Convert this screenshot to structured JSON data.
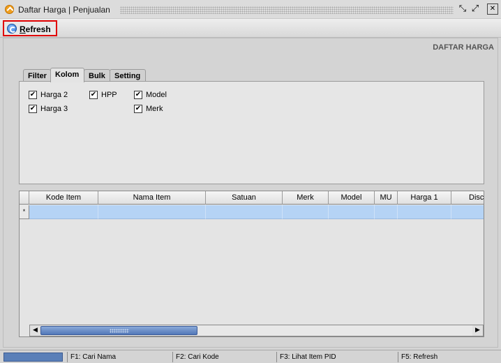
{
  "window": {
    "title": "Daftar Harga | Penjualan",
    "buttons": {
      "restore": "⤡",
      "maximize": "⤢",
      "close": "✕"
    }
  },
  "toolbar": {
    "refresh_mnemonic": "R",
    "refresh_rest": "efresh"
  },
  "panel": {
    "title": "DAFTAR HARGA"
  },
  "tabs": [
    {
      "label": "Filter",
      "active": false
    },
    {
      "label": "Kolom",
      "active": true
    },
    {
      "label": "Bulk",
      "active": false
    },
    {
      "label": "Setting",
      "active": false
    }
  ],
  "kolom": {
    "checkboxes": [
      {
        "label": "Harga 2",
        "checked": true
      },
      {
        "label": "Harga 3",
        "checked": true
      },
      {
        "label": "HPP",
        "checked": true
      },
      {
        "label": "Model",
        "checked": true
      },
      {
        "label": "Merk",
        "checked": true
      }
    ],
    "check_glyph": "✔"
  },
  "grid": {
    "columns": [
      "Kode Item",
      "Nama Item",
      "Satuan",
      "Merk",
      "Model",
      "MU",
      "Harga 1",
      "Disc"
    ],
    "new_row_marker": "*"
  },
  "scrollbar": {
    "left_arrow": "◀",
    "right_arrow": "▶"
  },
  "statusbar": {
    "items": [
      "F1: Cari Nama",
      "F2: Cari Kode",
      "F3: Lihat Item PID",
      "F5: Refresh"
    ]
  }
}
